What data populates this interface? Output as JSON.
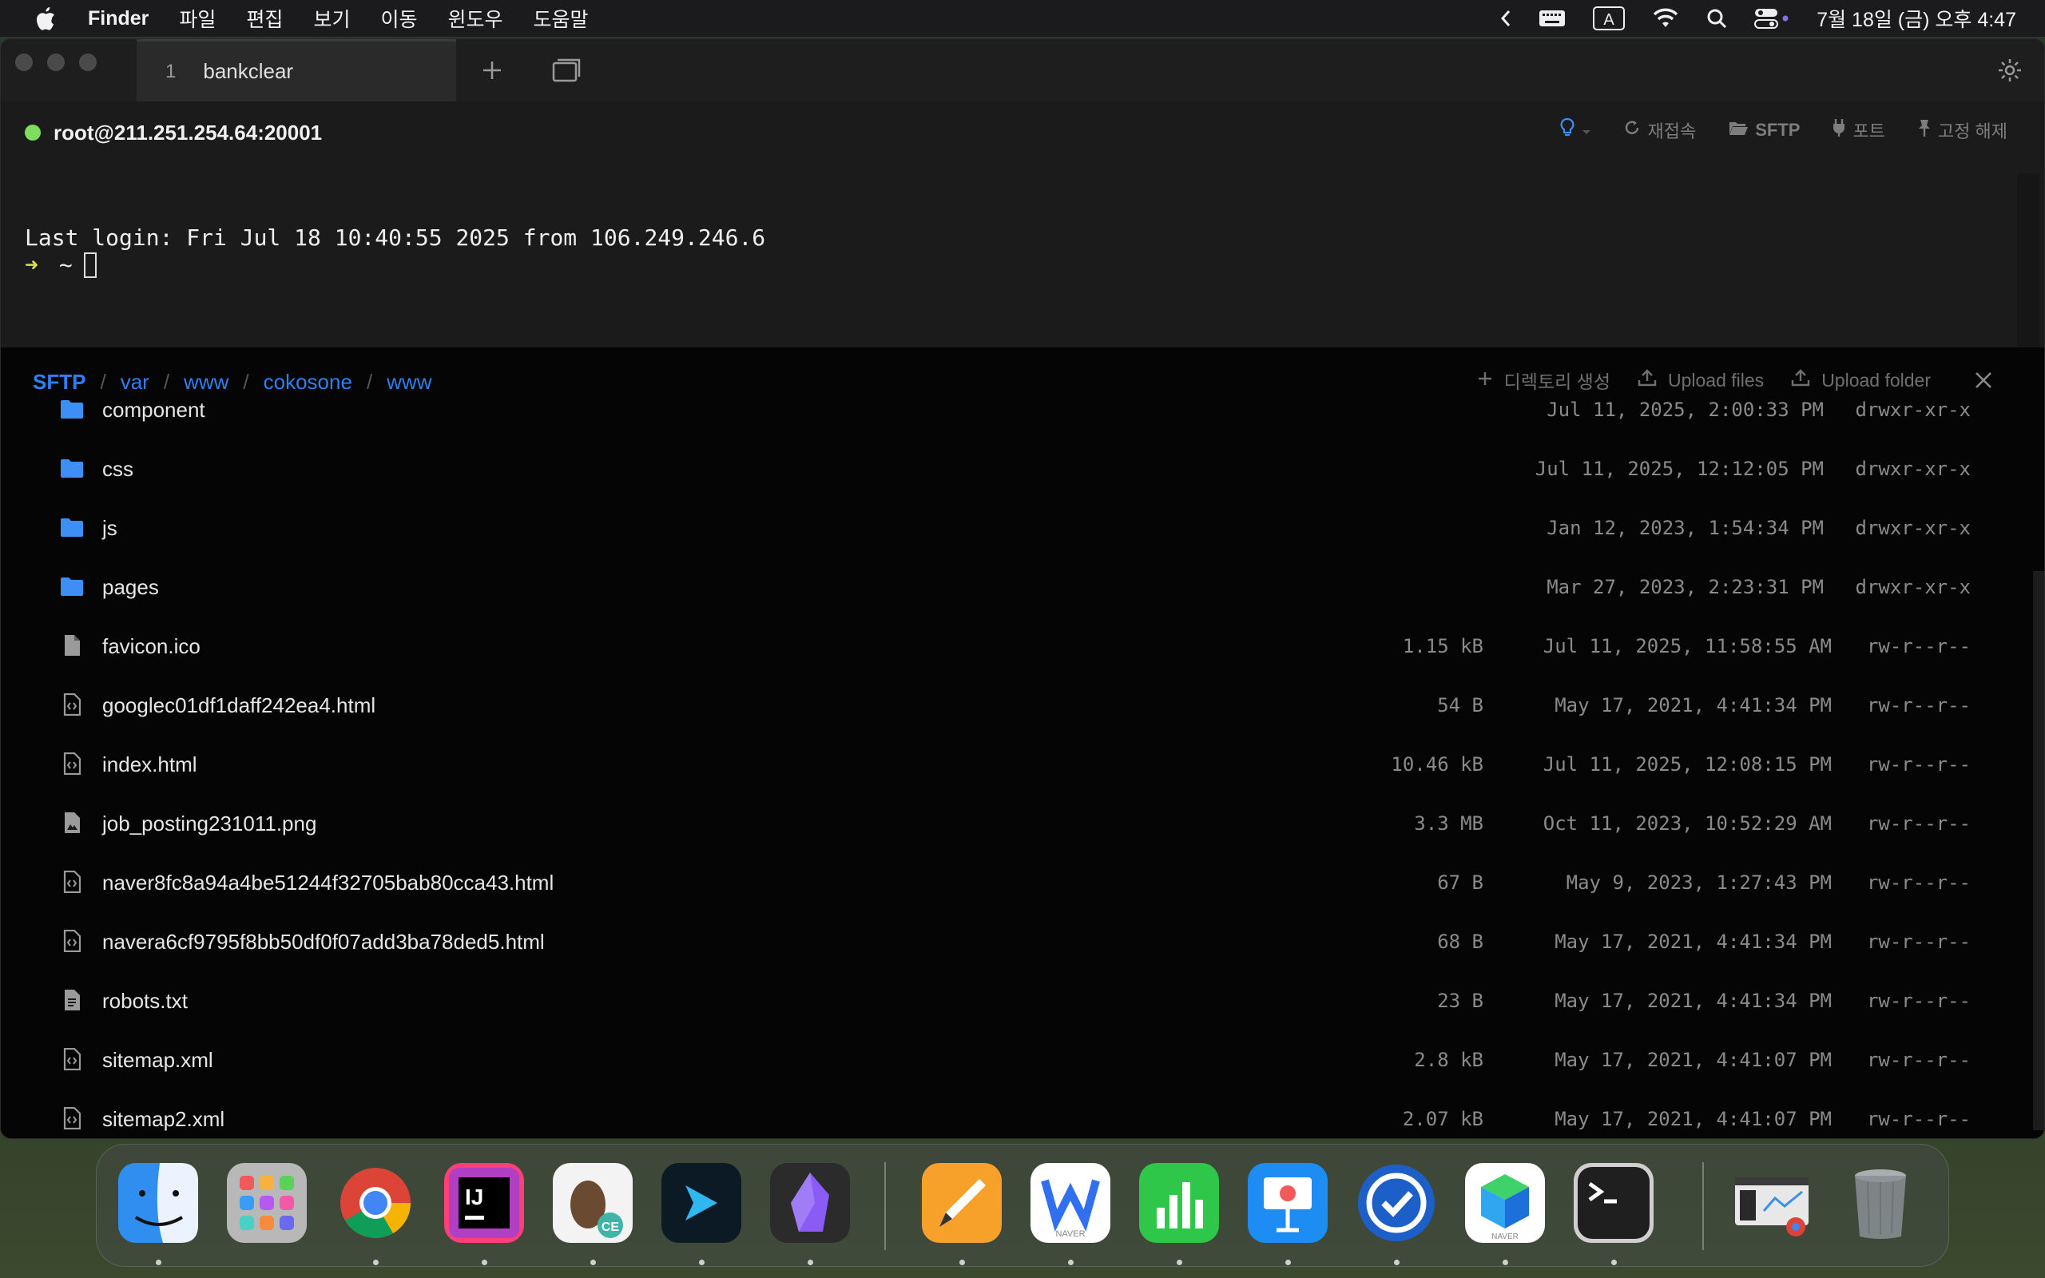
{
  "menubar": {
    "app": "Finder",
    "menus": [
      "파일",
      "편집",
      "보기",
      "이동",
      "윈도우",
      "도움말"
    ],
    "input_indicator": "A",
    "clock": "7월 18일 (금) 오후 4:47"
  },
  "tabs": [
    {
      "number": "1",
      "label": "bankclear"
    }
  ],
  "host": {
    "label": "root@211.251.254.64:20001",
    "status_color": "#7fdc5d",
    "actions": {
      "reconnect": "재접속",
      "sftp": "SFTP",
      "port": "포트",
      "unpin": "고정 해제"
    }
  },
  "terminal": {
    "line1": "Last login: Fri Jul 18 10:40:55 2025 from 106.249.246.6",
    "prompt_arrow": "➜",
    "prompt_dir": "~"
  },
  "sftp": {
    "breadcrumb": {
      "root": "SFTP",
      "segments": [
        "var",
        "www",
        "cokosone",
        "www"
      ]
    },
    "actions": {
      "new_dir": "디렉토리 생성",
      "upload_files": "Upload files",
      "upload_folder": "Upload folder"
    },
    "files": [
      {
        "name": "component",
        "type": "folder",
        "size": "",
        "date": "Jul 11, 2025, 2:00:33 PM",
        "perm": "drwxr-xr-x"
      },
      {
        "name": "css",
        "type": "folder",
        "size": "",
        "date": "Jul 11, 2025, 12:12:05 PM",
        "perm": "drwxr-xr-x"
      },
      {
        "name": "js",
        "type": "folder",
        "size": "",
        "date": "Jan 12, 2023, 1:54:34 PM",
        "perm": "drwxr-xr-x"
      },
      {
        "name": "pages",
        "type": "folder",
        "size": "",
        "date": "Mar 27, 2023, 2:23:31 PM",
        "perm": "drwxr-xr-x"
      },
      {
        "name": "favicon.ico",
        "type": "file",
        "size": "1.15 kB",
        "date": "Jul 11, 2025, 11:58:55 AM",
        "perm": "rw-r--r--"
      },
      {
        "name": "googlec01df1daff242ea4.html",
        "type": "code",
        "size": "54 B",
        "date": "May 17, 2021, 4:41:34 PM",
        "perm": "rw-r--r--"
      },
      {
        "name": "index.html",
        "type": "code",
        "size": "10.46 kB",
        "date": "Jul 11, 2025, 12:08:15 PM",
        "perm": "rw-r--r--"
      },
      {
        "name": "job_posting231011.png",
        "type": "image",
        "size": "3.3 MB",
        "date": "Oct 11, 2023, 10:52:29 AM",
        "perm": "rw-r--r--"
      },
      {
        "name": "naver8fc8a94a4be51244f32705bab80cca43.html",
        "type": "code",
        "size": "67 B",
        "date": "May 9, 2023, 1:27:43 PM",
        "perm": "rw-r--r--"
      },
      {
        "name": "navera6cf9795f8bb50df0f07add3ba78ded5.html",
        "type": "code",
        "size": "68 B",
        "date": "May 17, 2021, 4:41:34 PM",
        "perm": "rw-r--r--"
      },
      {
        "name": "robots.txt",
        "type": "text",
        "size": "23 B",
        "date": "May 17, 2021, 4:41:34 PM",
        "perm": "rw-r--r--"
      },
      {
        "name": "sitemap.xml",
        "type": "code",
        "size": "2.8 kB",
        "date": "May 17, 2021, 4:41:07 PM",
        "perm": "rw-r--r--"
      },
      {
        "name": "sitemap2.xml",
        "type": "code",
        "size": "2.07 kB",
        "date": "May 17, 2021, 4:41:07 PM",
        "perm": "rw-r--r--"
      }
    ]
  },
  "dock": {
    "apps": [
      {
        "name": "finder-icon",
        "color": "#2f8ef0",
        "running": true
      },
      {
        "name": "launchpad-icon",
        "color": "#9b9b9b",
        "running": false
      },
      {
        "name": "chrome-icon",
        "color": "#ffffff",
        "running": true
      },
      {
        "name": "intellij-icon",
        "color": "#ff3f7a",
        "running": true
      },
      {
        "name": "dbeaver-icon",
        "color": "#f3f3f3",
        "running": true
      },
      {
        "name": "termius-icon",
        "color": "#0c1a26",
        "running": true
      },
      {
        "name": "obsidian-icon",
        "color": "#2b2b2b",
        "running": true
      },
      {
        "name": "pages-icon",
        "color": "#f7a12a",
        "running": true
      },
      {
        "name": "naver-works-icon",
        "color": "#ffffff",
        "running": true
      },
      {
        "name": "numbers-icon",
        "color": "#2ec74a",
        "running": true
      },
      {
        "name": "keynote-icon",
        "color": "#1d8df4",
        "running": true
      },
      {
        "name": "sync-icon",
        "color": "#1d5fc9",
        "running": true
      },
      {
        "name": "naver-box-icon",
        "color": "#ffffff",
        "running": true
      },
      {
        "name": "terminal-icon",
        "color": "#1f1f1f",
        "running": true
      },
      {
        "name": "window-preview-icon",
        "color": "#3a3a3a",
        "running": false
      },
      {
        "name": "trash-icon",
        "color": "#8a8f94",
        "running": false
      }
    ],
    "dock_labels": {
      "naver_works": "NAVER",
      "naver_box": "NAVER",
      "dbeaver_badge": "CE"
    }
  }
}
